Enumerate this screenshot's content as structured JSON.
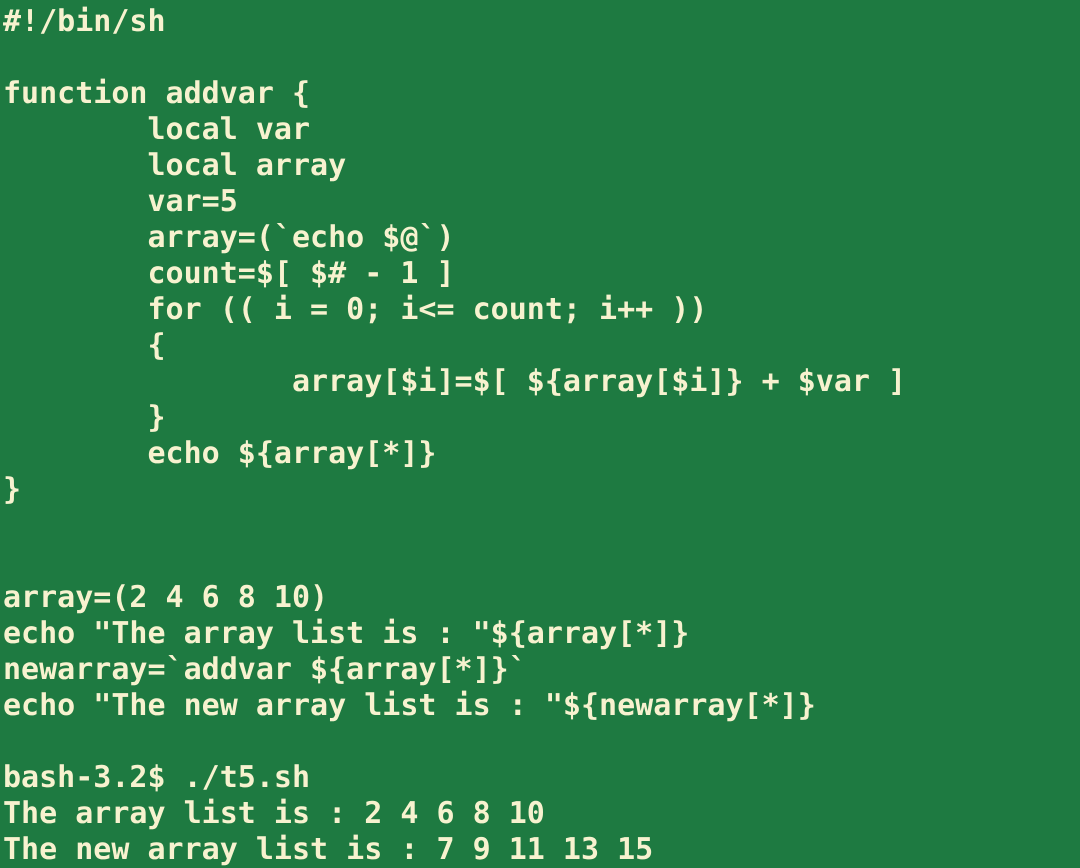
{
  "terminal": {
    "background_color": "#1e7a41",
    "text_color": "#f7f2cf",
    "prompt": "bash-3.2$",
    "script_name": "./t5.sh"
  },
  "script": {
    "shebang": "#!/bin/sh",
    "function_name": "addvar",
    "lines": [
      "#!/bin/sh",
      "",
      "function addvar {",
      "        local var",
      "        local array",
      "        var=5",
      "        array=(`echo $@`)",
      "        count=$[ $# - 1 ]",
      "        for (( i = 0; i<= count; i++ ))",
      "        {",
      "                array[$i]=$[ ${array[$i]} + $var ]",
      "        }",
      "        echo ${array[*]}",
      "}",
      "",
      "",
      "array=(2 4 6 8 10)",
      "echo \"The array list is : \"${array[*]}",
      "newarray=`addvar ${array[*]}`",
      "echo \"The new array list is : \"${newarray[*]}",
      "",
      "bash-3.2$ ./t5.sh",
      "The array list is : 2 4 6 8 10",
      "The new array list is : 7 9 11 13 15"
    ],
    "initial_array": "2 4 6 8 10",
    "var_value": "5",
    "output_array_line": "The array list is : 2 4 6 8 10",
    "output_newarray_line": "The new array list is : 7 9 11 13 15"
  }
}
